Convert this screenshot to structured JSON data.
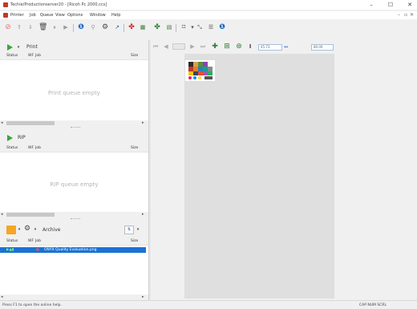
{
  "window": {
    "title": "Techie/Productionserver20 - [Ricoh Pc 2000.ccs]",
    "minimize": "–",
    "maximize": "☐",
    "close": "✕"
  },
  "menu": {
    "items": [
      "Printer",
      "Job",
      "Queue",
      "View",
      "Options",
      "Window",
      "Help"
    ],
    "mdi_min": "–",
    "mdi_restore": "▫",
    "mdi_close": "✕"
  },
  "viewer_toolbar": {
    "zoom_value": "45.73",
    "width_value": "80.00"
  },
  "print_panel": {
    "label": "Print",
    "columns": [
      "Status",
      "WF",
      "Job",
      "Size"
    ],
    "empty_text": "Print queue empty"
  },
  "rip_panel": {
    "label": "RIP",
    "columns": [
      "Status",
      "WF",
      "Job",
      "Size"
    ],
    "empty_text": "RIP queue empty"
  },
  "archive_panel": {
    "label": "Archive",
    "columns": [
      "Status",
      "WF",
      "Job",
      "Size"
    ],
    "rows": [
      {
        "job": "ONYX Quality Evaluation.png"
      }
    ]
  },
  "statusbar": {
    "help_text": "Press F1 to open the online help.",
    "right_text": "CAP NUM SCRL"
  },
  "colors": {
    "accent": "#1a73d4",
    "play_green": "#3aa63a",
    "info_blue": "#1565c0"
  }
}
